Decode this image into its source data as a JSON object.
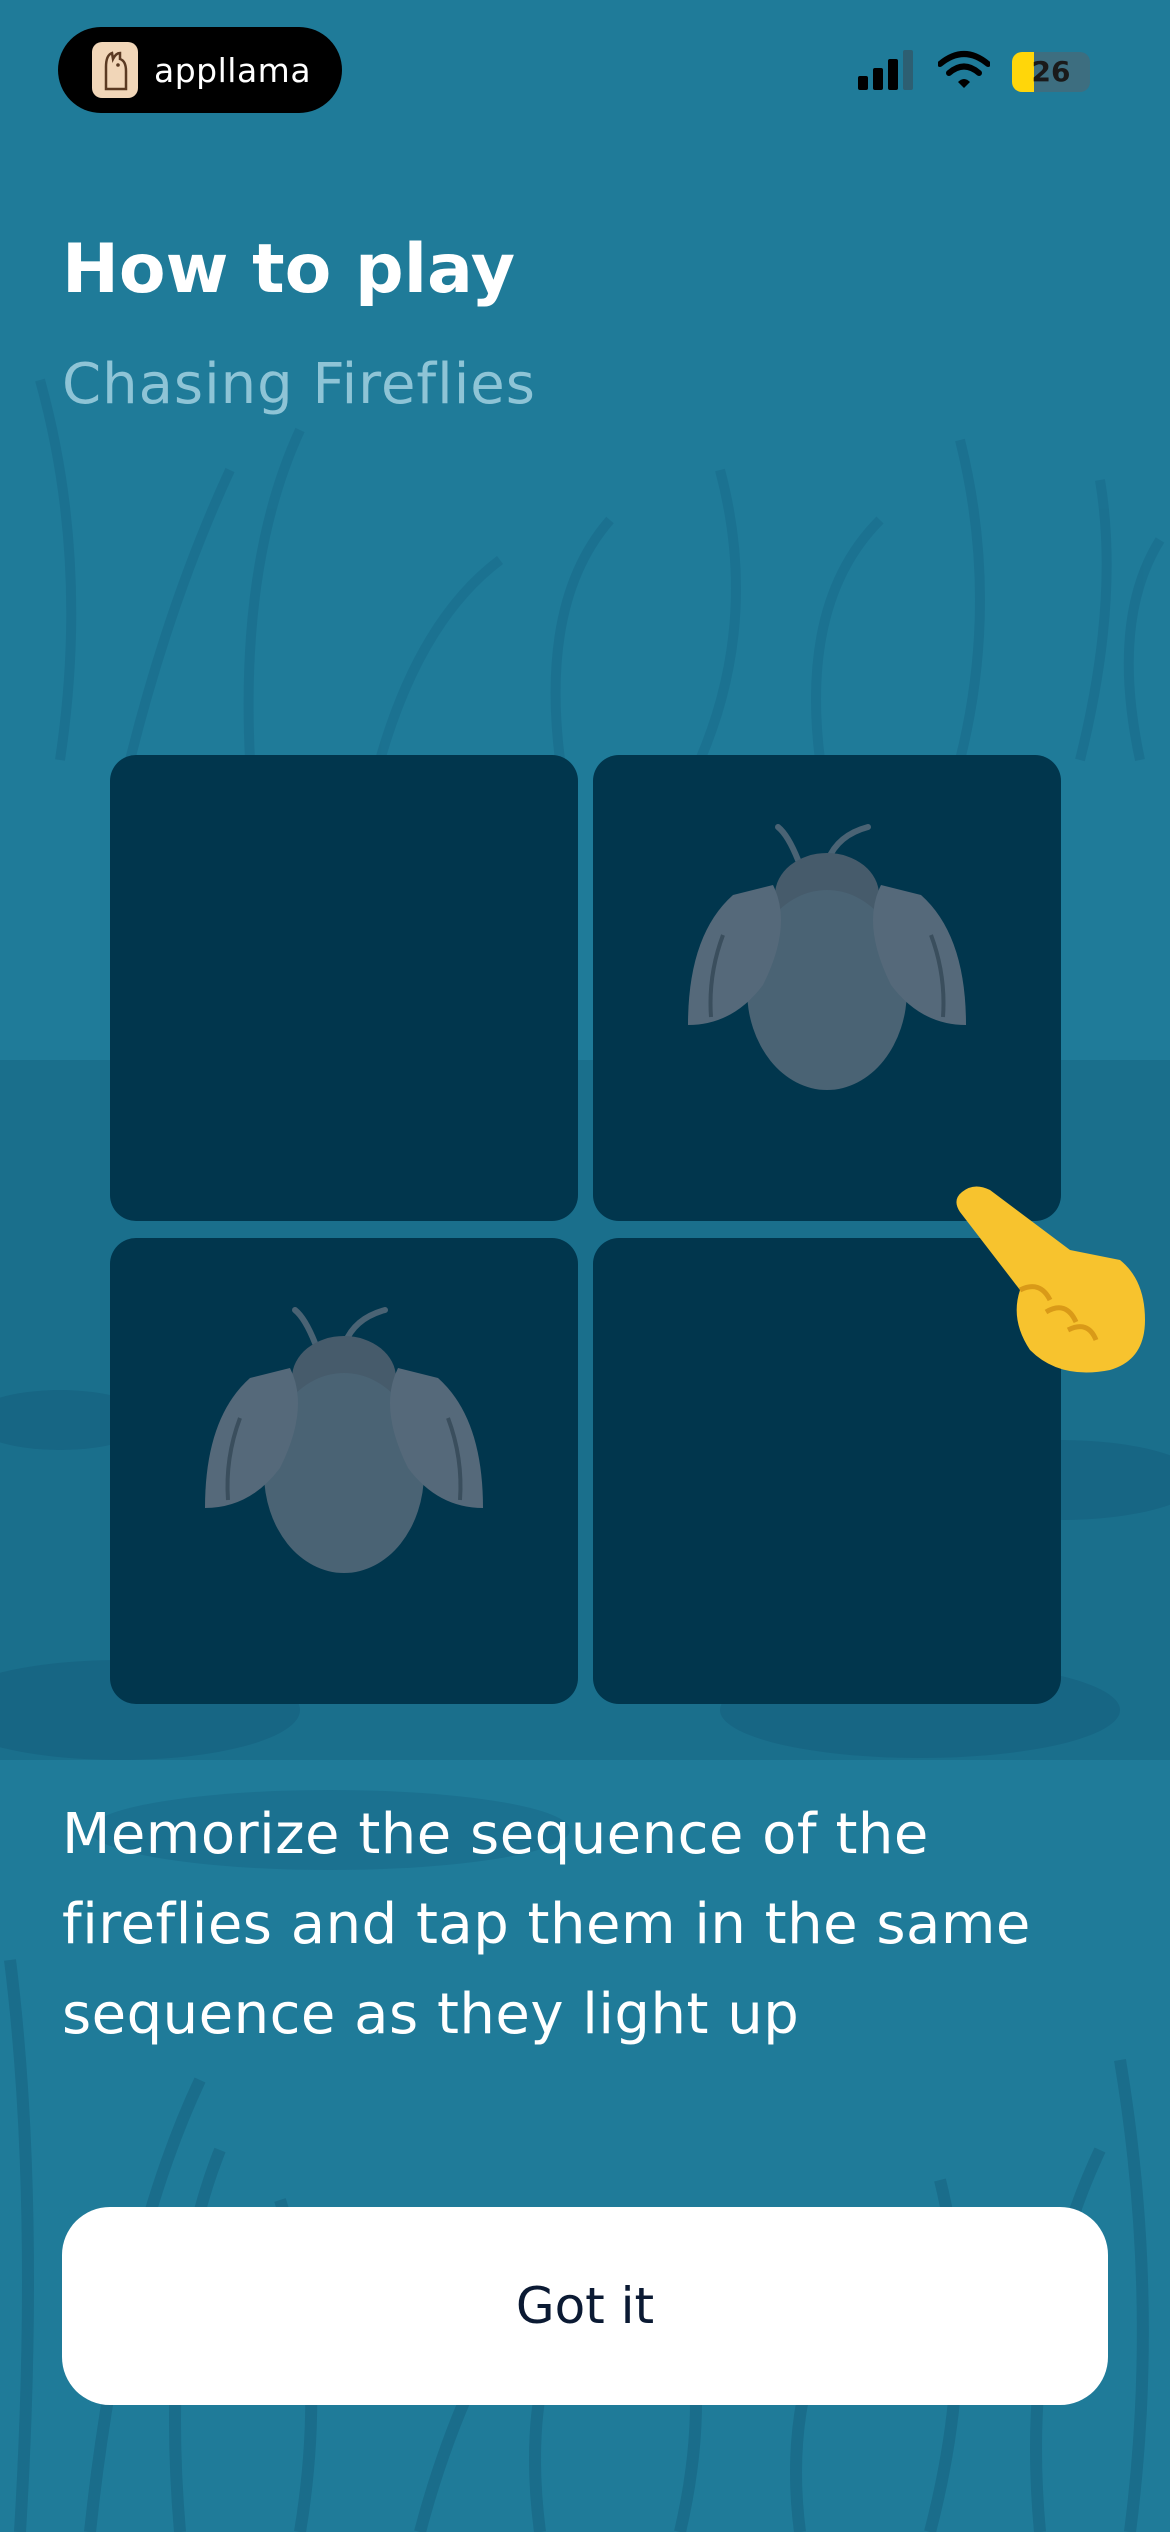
{
  "status_bar": {
    "brand": "appllama",
    "battery": "26",
    "icons": [
      "cellular-signal-icon",
      "wifi-icon",
      "battery-icon"
    ]
  },
  "header": {
    "title": "How to play",
    "subtitle": "Chasing Fireflies"
  },
  "game_grid": {
    "tiles": [
      {
        "position": "top-left",
        "has_firefly": false
      },
      {
        "position": "top-right",
        "has_firefly": true
      },
      {
        "position": "bottom-left",
        "has_firefly": true
      },
      {
        "position": "bottom-right",
        "has_firefly": false
      }
    ],
    "pointer_icon": "pointing-hand-icon"
  },
  "instructions": "Memorize the sequence of the fireflies and tap them in the same sequence as they light up",
  "button": {
    "label": "Got it"
  },
  "colors": {
    "background": "#1f7b99",
    "tile": "#01364d",
    "subtitle": "#8ec4d6",
    "firefly": "#4a6374"
  }
}
